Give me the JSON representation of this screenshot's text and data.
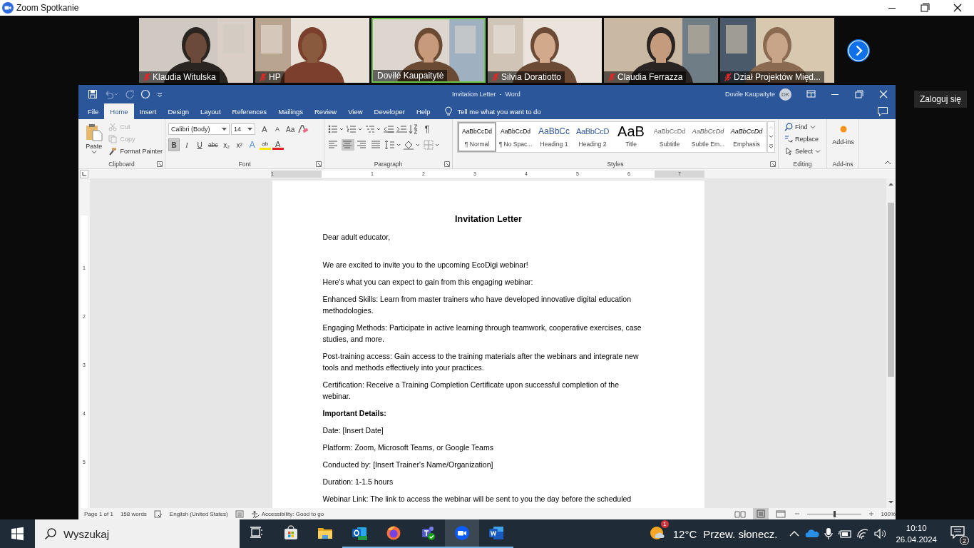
{
  "zoom": {
    "title": "Zoom Spotkanie",
    "sign_in": "Zaloguj się",
    "tiles": [
      {
        "name": "Klaudia Witulska",
        "muted": true,
        "selected": false
      },
      {
        "name": "HP",
        "muted": true,
        "selected": false
      },
      {
        "name": "Dovilė Kaupaitytė",
        "muted": false,
        "selected": true
      },
      {
        "name": "Silvia Doratiotto",
        "muted": true,
        "selected": false
      },
      {
        "name": "Claudia Ferrazza",
        "muted": true,
        "selected": false
      },
      {
        "name": "Dział Projektów Międ...",
        "muted": true,
        "selected": false
      }
    ]
  },
  "word": {
    "title": "Invitation Letter  -  Word",
    "user": "Dovile Kaupaityte",
    "avatar": "DK",
    "tabs": [
      {
        "label": "File",
        "selected": false
      },
      {
        "label": "Home",
        "selected": true
      },
      {
        "label": "Insert",
        "selected": false
      },
      {
        "label": "Design",
        "selected": false
      },
      {
        "label": "Layout",
        "selected": false
      },
      {
        "label": "References",
        "selected": false
      },
      {
        "label": "Mailings",
        "selected": false
      },
      {
        "label": "Review",
        "selected": false
      },
      {
        "label": "View",
        "selected": false
      },
      {
        "label": "Developer",
        "selected": false
      },
      {
        "label": "Help",
        "selected": false
      }
    ],
    "tell_me": "Tell me what you want to do",
    "clipboard": {
      "label": "Clipboard",
      "paste": "Paste",
      "format_painter": "Format Painter",
      "items": [
        {
          "label": "Cut",
          "disabled": true
        },
        {
          "label": "Copy",
          "disabled": true
        }
      ]
    },
    "font": {
      "label": "Font",
      "name": "Calibri (Body)",
      "size": "14",
      "case_buttons": [
        {
          "kind": "grow",
          "label": "A"
        },
        {
          "kind": "shrink",
          "label": "A"
        },
        {
          "kind": "case",
          "label": "Aa"
        }
      ],
      "format_buttons": [
        {
          "label": "B",
          "pressed": true
        },
        {
          "label": "I",
          "pressed": false
        },
        {
          "label": "U",
          "pressed": false
        },
        {
          "label": "abc",
          "pressed": false
        },
        {
          "label": "x₂",
          "pressed": false
        },
        {
          "label": "x²",
          "pressed": false
        }
      ],
      "color_buttons": [
        {
          "kind": "effects",
          "label": "A"
        },
        {
          "kind": "highlight",
          "label": "ab"
        },
        {
          "kind": "color",
          "label": "A"
        }
      ]
    },
    "paragraph": {
      "label": "Paragraph",
      "pilcrow": "¶",
      "align": [
        {
          "kind": "left",
          "selected": false
        },
        {
          "kind": "center",
          "selected": true
        },
        {
          "kind": "right",
          "selected": false
        },
        {
          "kind": "justify",
          "selected": false
        }
      ]
    },
    "styles": {
      "label": "Styles",
      "items": [
        {
          "kind": "normal",
          "preview": "AaBbCcDd",
          "name": "¶ Normal",
          "selected": true
        },
        {
          "kind": "nospacing",
          "preview": "AaBbCcDd",
          "name": "¶ No Spac...",
          "selected": false
        },
        {
          "kind": "heading1",
          "preview": "AaBbCc",
          "name": "Heading 1",
          "selected": false
        },
        {
          "kind": "heading2",
          "preview": "AaBbCcD",
          "name": "Heading 2",
          "selected": false
        },
        {
          "kind": "title",
          "preview": "AaB",
          "name": "Title",
          "selected": false
        },
        {
          "kind": "subtitle",
          "preview": "AaBbCcDd",
          "name": "Subtitle",
          "selected": false
        },
        {
          "kind": "subtle",
          "preview": "AaBbCcDd",
          "name": "Subtle Em...",
          "selected": false
        },
        {
          "kind": "emphasis",
          "preview": "AaBbCcDd",
          "name": "Emphasis",
          "selected": false
        }
      ]
    },
    "editing": {
      "label": "Editing",
      "find": "Find",
      "replace": "Replace",
      "select": "Select"
    },
    "addins": {
      "label": "Add-ins",
      "button": "Add-ins"
    },
    "ruler": {
      "numbers": [
        "1",
        "1",
        "2",
        "3",
        "4",
        "5",
        "6",
        "7"
      ],
      "vertical_numbers": [
        "1",
        "2",
        "3",
        "4",
        "5"
      ]
    },
    "document": [
      {
        "kind": "title",
        "text": "Invitation Letter"
      },
      {
        "kind": "greeting",
        "text": "Dear adult educator,"
      },
      {
        "kind": "body",
        "text": "We are excited to invite you to the upcoming EcoDigi webinar!"
      },
      {
        "kind": "body",
        "text": "Here's what you can expect to gain from this engaging webinar:"
      },
      {
        "kind": "body",
        "text": "Enhanced Skills: Learn from master trainers who have developed innovative digital education methodologies."
      },
      {
        "kind": "body",
        "text": "Engaging Methods: Participate in active learning through teamwork, cooperative exercises, case studies, and more."
      },
      {
        "kind": "body",
        "text": "Post-training access: Gain access to the training materials after the webinars and integrate new tools and methods effectively into your practices."
      },
      {
        "kind": "body",
        "text": "Certification: Receive a Training Completion Certificate upon successful completion of the webinar."
      },
      {
        "kind": "heading",
        "text": "Important Details:"
      },
      {
        "kind": "body",
        "text": "Date: [Insert Date]"
      },
      {
        "kind": "body",
        "text": "Platform: Zoom, Microsoft Teams, or Google Teams"
      },
      {
        "kind": "body",
        "text": "Conducted by: [Insert Trainer's Name/Organization]"
      },
      {
        "kind": "body",
        "text": "Duration: 1-1.5 hours"
      },
      {
        "kind": "body",
        "text": "Webinar Link: The link to access the webinar will be sent to you the day before the scheduled"
      }
    ],
    "status": {
      "page": "Page 1 of 1",
      "words": "158 words",
      "language": "English (United States)",
      "accessibility": "Accessibility: Good to go",
      "zoom_slider": {
        "level": 0.5
      },
      "zoom_percent": "100%"
    }
  },
  "taskbar": {
    "search_placeholder": "Wyszukaj",
    "apps": [
      {
        "kind": "taskview",
        "open": false,
        "selected": false
      },
      {
        "kind": "store",
        "open": false,
        "selected": false
      },
      {
        "kind": "explorer",
        "open": false,
        "selected": false
      },
      {
        "kind": "outlook",
        "open": true,
        "selected": false
      },
      {
        "kind": "firefox",
        "open": true,
        "selected": false
      },
      {
        "kind": "teams",
        "open": true,
        "selected": false
      },
      {
        "kind": "zoom",
        "open": true,
        "selected": true
      },
      {
        "kind": "word",
        "open": true,
        "selected": false
      }
    ],
    "weather": {
      "badge": "1",
      "temperature": "12°C",
      "description": "Przew. słonecz."
    },
    "time": "10:10",
    "date": "26.04.2024",
    "notifications": "2"
  }
}
